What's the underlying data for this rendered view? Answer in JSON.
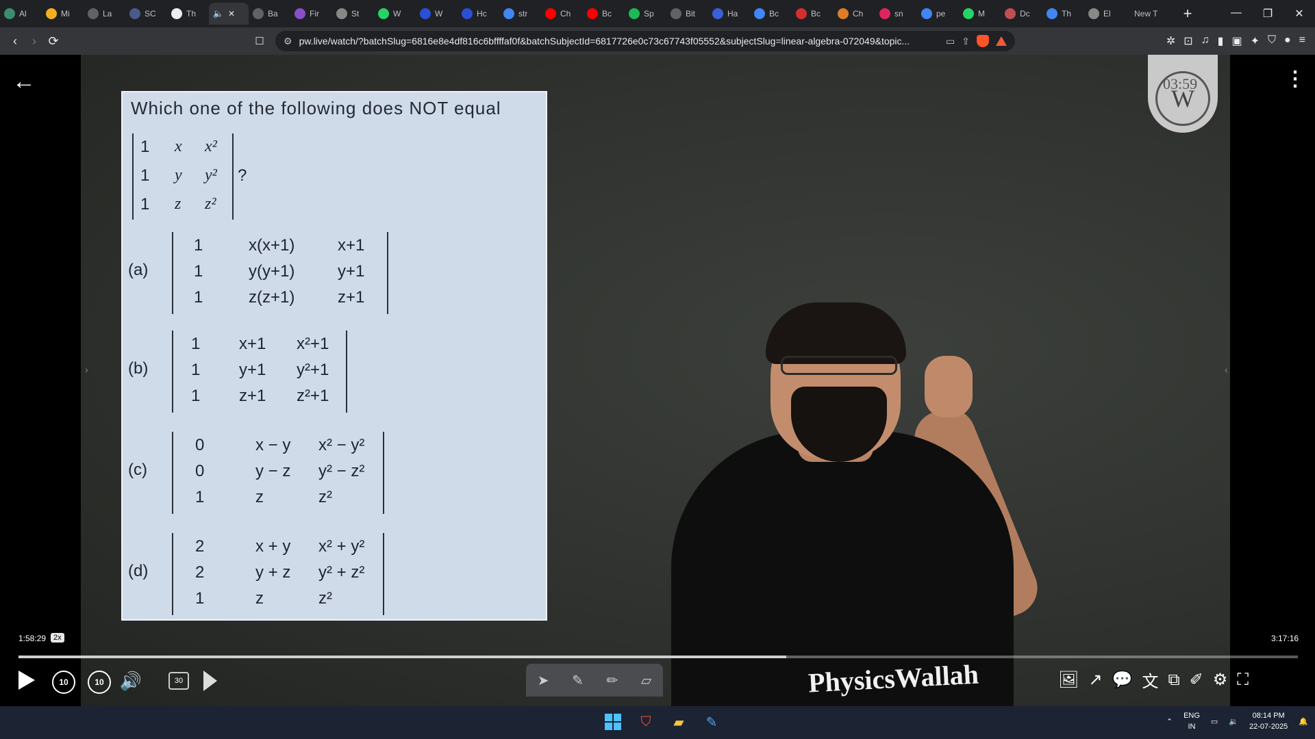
{
  "browser": {
    "tabs": [
      {
        "title": "Al",
        "color": "#3c8c6e"
      },
      {
        "title": "Mi",
        "color": "#f0b020"
      },
      {
        "title": "La",
        "color": "#5f6368"
      },
      {
        "title": "SC",
        "color": "#4a5a8a"
      },
      {
        "title": "Th",
        "color": "#eeeeee"
      },
      {
        "title": "Ba",
        "color": "#5f6368"
      },
      {
        "title": "Fir",
        "color": "#8a4fc8"
      },
      {
        "title": "St",
        "color": "#888888"
      },
      {
        "title": "W",
        "color": "#25d366"
      },
      {
        "title": "W",
        "color": "#2a4fd8"
      },
      {
        "title": "Hc",
        "color": "#2a4fd8"
      },
      {
        "title": "str",
        "color": "#4285f4"
      },
      {
        "title": "Ch",
        "color": "#ff0000"
      },
      {
        "title": "Bc",
        "color": "#ff0000"
      },
      {
        "title": "Sp",
        "color": "#1db954"
      },
      {
        "title": "Bit",
        "color": "#5f6368"
      },
      {
        "title": "Ha",
        "color": "#3b5fd6"
      },
      {
        "title": "Bc",
        "color": "#4285f4"
      },
      {
        "title": "Bc",
        "color": "#d32f2f"
      },
      {
        "title": "Ch",
        "color": "#e07b2a"
      },
      {
        "title": "sn",
        "color": "#e0245e"
      },
      {
        "title": "pe",
        "color": "#4285f4"
      },
      {
        "title": "M",
        "color": "#25d366"
      },
      {
        "title": "Dc",
        "color": "#c05050"
      },
      {
        "title": "Th",
        "color": "#4285f4"
      },
      {
        "title": "El",
        "color": "#888888"
      }
    ],
    "active_tab_title": "",
    "new_tab_label": "New T",
    "url": "pw.live/watch/?batchSlug=6816e8e4df816c6bffffaf0f&batchSubjectId=6817726e0c73c67743f05552&subjectSlug=linear-algebra-072049&topic..."
  },
  "question": {
    "title": "Which one of the following does NOT equal",
    "qmark": "?",
    "main_det": {
      "rows": [
        [
          "1",
          "x",
          "x²"
        ],
        [
          "1",
          "y",
          "y²"
        ],
        [
          "1",
          "z",
          "z²"
        ]
      ]
    },
    "options": [
      {
        "label": "(a)",
        "rows": [
          [
            "1",
            "x(x+1)",
            "x+1"
          ],
          [
            "1",
            "y(y+1)",
            "y+1"
          ],
          [
            "1",
            "z(z+1)",
            "z+1"
          ]
        ]
      },
      {
        "label": "(b)",
        "rows": [
          [
            "1",
            "x+1",
            "x²+1"
          ],
          [
            "1",
            "y+1",
            "y²+1"
          ],
          [
            "1",
            "z+1",
            "z²+1"
          ]
        ]
      },
      {
        "label": "(c)",
        "rows": [
          [
            "0",
            "x − y",
            "x² − y²"
          ],
          [
            "0",
            "y − z",
            "y² − z²"
          ],
          [
            "1",
            "z",
            "z²"
          ]
        ]
      },
      {
        "label": "(d)",
        "rows": [
          [
            "2",
            "x + y",
            "x² + y²"
          ],
          [
            "2",
            "y + z",
            "y² + z²"
          ],
          [
            "1",
            "z",
            "z²"
          ]
        ]
      }
    ]
  },
  "overlay": {
    "logo_letters": "W",
    "logo_timer": "03:59",
    "brand": "PhysicsWallah"
  },
  "player": {
    "current_time": "1:58:29",
    "speed": "2x",
    "total_time": "3:17:16",
    "progress": 0.6,
    "buffered": 0.6,
    "rewind_label": "10",
    "forward_label": "10",
    "skip30_label": "30"
  },
  "taskbar": {
    "lang_top": "ENG",
    "lang_bottom": "IN",
    "time": "08:14 PM",
    "date": "22-07-2025"
  }
}
